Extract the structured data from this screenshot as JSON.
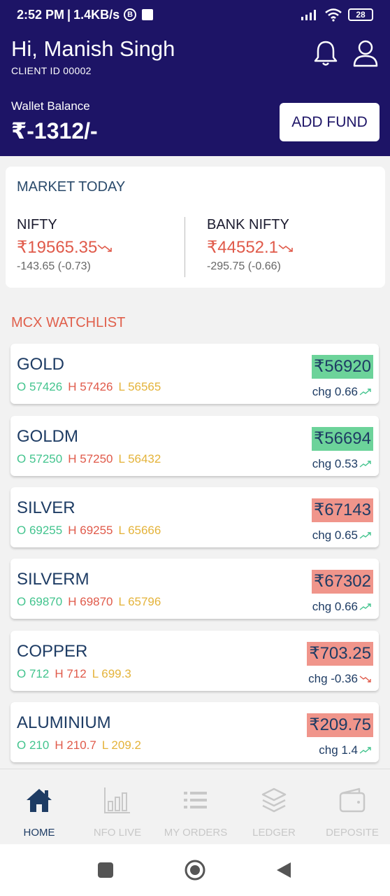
{
  "status_bar": {
    "time": "2:52 PM",
    "speed": "1.4KB/s",
    "badge": "B",
    "battery": "28"
  },
  "header": {
    "greeting": "Hi, Manish Singh",
    "client_id": "CLIENT ID 00002",
    "wallet_label": "Wallet Balance",
    "wallet_value": "₹-1312/-",
    "add_fund_label": "ADD FUND"
  },
  "market": {
    "title": "MARKET TODAY",
    "indices": [
      {
        "name": "NIFTY",
        "price": "₹19565.35",
        "change": "-143.65 (-0.73)",
        "trend": "down"
      },
      {
        "name": "BANK NIFTY",
        "price": "₹44552.1",
        "change": "-295.75 (-0.66)",
        "trend": "down"
      }
    ]
  },
  "watchlist": {
    "title": "MCX WATCHLIST",
    "items": [
      {
        "name": "GOLD",
        "o": "O 57426",
        "h": "H 57426",
        "l": "L 56565",
        "price": "₹56920",
        "chg": "chg 0.66",
        "trend": "up"
      },
      {
        "name": "GOLDM",
        "o": "O 57250",
        "h": "H 57250",
        "l": "L 56432",
        "price": "₹56694",
        "chg": "chg 0.53",
        "trend": "up"
      },
      {
        "name": "SILVER",
        "o": "O 69255",
        "h": "H 69255",
        "l": "L 65666",
        "price": "₹67143",
        "chg": "chg 0.65",
        "trend": "down"
      },
      {
        "name": "SILVERM",
        "o": "O 69870",
        "h": "H 69870",
        "l": "L 65796",
        "price": "₹67302",
        "chg": "chg 0.66",
        "trend": "down"
      },
      {
        "name": "COPPER",
        "o": "O 712",
        "h": "H 712",
        "l": "L 699.3",
        "price": "₹703.25",
        "chg": "chg -0.36",
        "trend": "down"
      },
      {
        "name": "ALUMINIUM",
        "o": "O 210",
        "h": "H 210.7",
        "l": "L 209.2",
        "price": "₹209.75",
        "chg": "chg 1.4",
        "trend": "down"
      }
    ]
  },
  "bottom_nav": {
    "items": [
      {
        "label": "HOME",
        "icon": "home-icon",
        "active": true
      },
      {
        "label": "NFO LIVE",
        "icon": "bar-chart-icon",
        "active": false
      },
      {
        "label": "MY ORDERS",
        "icon": "list-icon",
        "active": false
      },
      {
        "label": "LEDGER",
        "icon": "layers-icon",
        "active": false
      },
      {
        "label": "DEPOSITE",
        "icon": "wallet-icon",
        "active": false
      }
    ]
  },
  "colors": {
    "header_bg": "#1d1466",
    "up_bg": "#6cd39a",
    "down_bg": "#f0958b",
    "down_text": "#e05a4a",
    "up_trend": "#43c48e"
  }
}
